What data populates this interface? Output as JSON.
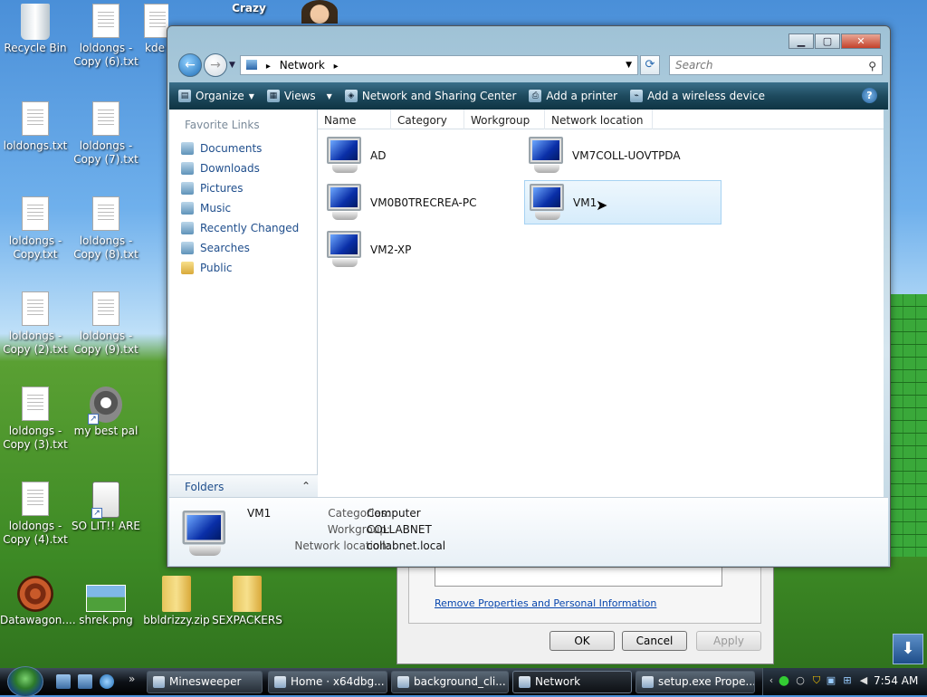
{
  "desktop": {
    "icons": [
      {
        "label": "Recycle Bin"
      },
      {
        "label": "loldongs - Copy (6).txt"
      },
      {
        "label": "kde"
      },
      {
        "label": "Crazy"
      },
      {
        "label": "loldongs.txt"
      },
      {
        "label": "loldongs - Copy (7).txt"
      },
      {
        "label": "loldongs - Copy.txt"
      },
      {
        "label": "loldongs - Copy (8).txt"
      },
      {
        "label": "loldongs - Copy (2).txt"
      },
      {
        "label": "loldongs - Copy (9).txt"
      },
      {
        "label": "loldongs - Copy (3).txt"
      },
      {
        "label": "my best pal"
      },
      {
        "label": "loldongs - Copy (4).txt"
      },
      {
        "label": "SO LIT!! ARE"
      },
      {
        "label": "Datawagon...."
      },
      {
        "label": "shrek.png"
      },
      {
        "label": "bbldrizzy.zip"
      },
      {
        "label": "SEXPACKERS"
      }
    ]
  },
  "window": {
    "address": {
      "root": "Network",
      "sep": "▸"
    },
    "search_placeholder": "Search",
    "toolbar": {
      "organize": "Organize",
      "views": "Views",
      "network_sharing": "Network and Sharing Center",
      "add_printer": "Add a printer",
      "add_wireless": "Add a wireless device"
    },
    "favorite_links_title": "Favorite Links",
    "favorites": [
      "Documents",
      "Downloads",
      "Pictures",
      "Music",
      "Recently Changed",
      "Searches",
      "Public"
    ],
    "folders_label": "Folders",
    "columns": [
      "Name",
      "Category",
      "Workgroup",
      "Network location"
    ],
    "computers": [
      "AD",
      "VM7COLL-UOVTPDA",
      "VM0B0TRECREA-PC",
      "VM1",
      "VM2-XP"
    ],
    "details": {
      "name": "VM1",
      "categories_label": "Categories:",
      "categories": "Computer",
      "workgroup_label": "Workgroup:",
      "workgroup": "COLLABNET",
      "network_location_label": "Network location:",
      "network_location": "collabnet.local"
    }
  },
  "background_dialog": {
    "link": "Remove Properties and Personal Information",
    "ok": "OK",
    "cancel": "Cancel",
    "apply": "Apply"
  },
  "taskbar": {
    "tasks": [
      "Minesweeper",
      "Home · x64dbg...",
      "background_cli...",
      "Network",
      "setup.exe Prope..."
    ],
    "clock": "7:54 AM"
  },
  "colors": {
    "toolbar": "#1e4a5e",
    "link": "#1f4e8c",
    "selection": "#d6ecfb"
  }
}
